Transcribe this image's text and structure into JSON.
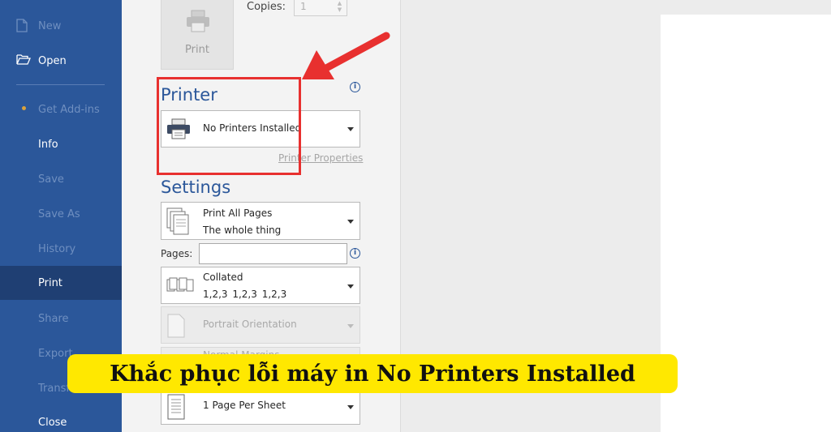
{
  "sidebar": {
    "items": [
      {
        "label": "New",
        "icon": "new-document-icon",
        "state": "disabled"
      },
      {
        "label": "Open",
        "icon": "open-folder-icon",
        "state": "normal"
      },
      {
        "label": "Get Add-ins",
        "state": "disabled"
      },
      {
        "label": "Info",
        "state": "normal"
      },
      {
        "label": "Save",
        "state": "disabled"
      },
      {
        "label": "Save As",
        "state": "disabled"
      },
      {
        "label": "History",
        "state": "disabled"
      },
      {
        "label": "Print",
        "state": "active"
      },
      {
        "label": "Share",
        "state": "disabled"
      },
      {
        "label": "Export",
        "state": "disabled"
      },
      {
        "label": "Transform",
        "state": "disabled"
      },
      {
        "label": "Close",
        "state": "normal"
      }
    ]
  },
  "print": {
    "button_label": "Print",
    "copies_label": "Copies:",
    "copies_value": "1"
  },
  "printer": {
    "title": "Printer",
    "selected": "No Printers Installed",
    "properties_link": "Printer Properties"
  },
  "settings": {
    "title": "Settings",
    "range": {
      "line1": "Print All Pages",
      "line2": "The whole thing"
    },
    "pages_label": "Pages:",
    "pages_value": "",
    "collation": {
      "line1": "Collated",
      "line2": "1,2,3    1,2,3    1,2,3"
    },
    "orientation": "Portrait Orientation",
    "margins_partial": "Normal Margins",
    "per_sheet": "1 Page Per Sheet"
  },
  "caption": "Khắc phục lỗi máy in No Printers Installed",
  "colors": {
    "sidebar": "#2b579a",
    "accent": "#2b579a",
    "highlight_red": "#e8302f",
    "caption_bg": "#ffe800"
  }
}
